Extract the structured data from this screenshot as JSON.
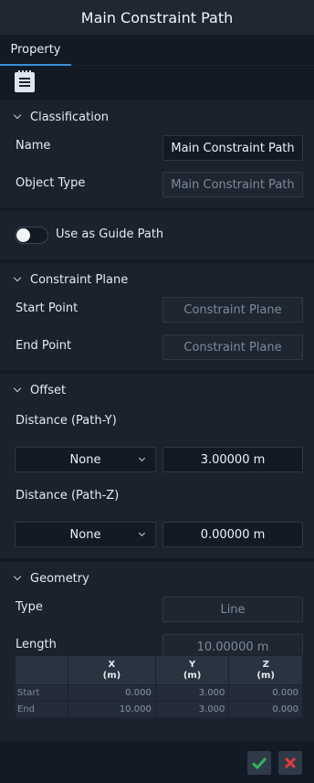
{
  "window": {
    "title": "Main Constraint Path"
  },
  "tabs": [
    {
      "label": "Property"
    }
  ],
  "toolbar": {
    "icon": "notepad-icon"
  },
  "classification": {
    "header": "Classification",
    "name_label": "Name",
    "name_value": "Main Constraint Path",
    "type_label": "Object Type",
    "type_value": "Main Constraint Path"
  },
  "guide": {
    "label": "Use as Guide Path",
    "enabled": false
  },
  "constraint_plane": {
    "header": "Constraint Plane",
    "start_label": "Start Point",
    "start_value": "Constraint Plane",
    "end_label": "End Point",
    "end_value": "Constraint Plane"
  },
  "offset": {
    "header": "Offset",
    "y_label": "Distance (Path-Y)",
    "y_mode": "None",
    "y_value": "3.00000 m",
    "z_label": "Distance (Path-Z)",
    "z_mode": "None",
    "z_value": "0.00000 m"
  },
  "geometry": {
    "header": "Geometry",
    "type_label": "Type",
    "type_value": "Line",
    "length_label": "Length",
    "length_value": "10.00000 m",
    "table": {
      "columns": [
        {
          "name": "X",
          "unit": "(m)"
        },
        {
          "name": "Y",
          "unit": "(m)"
        },
        {
          "name": "Z",
          "unit": "(m)"
        }
      ],
      "rows": [
        {
          "label": "Start",
          "x": "0.000",
          "y": "3.000",
          "z": "0.000"
        },
        {
          "label": "End",
          "x": "10.000",
          "y": "3.000",
          "z": "0.000"
        }
      ]
    }
  },
  "footer": {
    "ok_icon": "check-icon",
    "cancel_icon": "close-icon"
  },
  "colors": {
    "accent": "#3a8fd6",
    "ok": "#35b25b",
    "cancel": "#e0393e"
  }
}
